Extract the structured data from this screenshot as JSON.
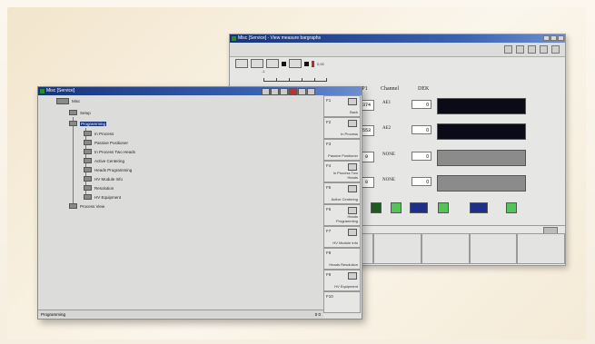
{
  "back_window": {
    "title": "Misc [Service] - View measure bargraphs",
    "toolbar_text": "0,00",
    "scale_label": "-1",
    "headers": {
      "col1": "MP1",
      "col2": "Channel",
      "col3": "DEK"
    },
    "rows": [
      {
        "left": "374",
        "name": "AE1",
        "value": "0",
        "bar": "dark"
      },
      {
        "left": "553",
        "name": "AE2",
        "value": "0",
        "bar": "dark"
      },
      {
        "left": "0",
        "name": "NONE",
        "value": "0",
        "bar": "gray"
      },
      {
        "left": "0",
        "name": "NONE",
        "value": "0",
        "bar": "gray"
      }
    ]
  },
  "front_window": {
    "title": "Misc [Service]",
    "tree": [
      {
        "label": "Misc",
        "level": 0,
        "selected": false
      },
      {
        "label": "Setup",
        "level": 1,
        "selected": false
      },
      {
        "label": "Programming",
        "level": 1,
        "selected": true
      },
      {
        "label": "In Process",
        "level": 2,
        "selected": false
      },
      {
        "label": "Passive Positioner",
        "level": 2,
        "selected": false
      },
      {
        "label": "In Process Two Heads",
        "level": 2,
        "selected": false
      },
      {
        "label": "Active Centering",
        "level": 2,
        "selected": false
      },
      {
        "label": "Heads Programming",
        "level": 2,
        "selected": false
      },
      {
        "label": "HV Module Info",
        "level": 2,
        "selected": false
      },
      {
        "label": "Resolution",
        "level": 2,
        "selected": false
      },
      {
        "label": "HV Equipment",
        "level": 2,
        "selected": false
      },
      {
        "label": "Process View",
        "level": 1,
        "selected": false
      }
    ],
    "fkeys": [
      {
        "key": "F1",
        "label": "Back"
      },
      {
        "key": "F2",
        "label": "In Process"
      },
      {
        "key": "F3",
        "label": "Passive Positioner"
      },
      {
        "key": "F4",
        "label": "In Process Two Heads"
      },
      {
        "key": "F5",
        "label": "Active Centering"
      },
      {
        "key": "F6",
        "label": "Heads Programming"
      },
      {
        "key": "F7",
        "label": "HV Module Info"
      },
      {
        "key": "F8",
        "label": "Heads Resolution"
      },
      {
        "key": "F9",
        "label": "HV Equipment"
      },
      {
        "key": "F10",
        "label": ""
      }
    ],
    "status_text": "Programming",
    "status_right": "0 0"
  }
}
